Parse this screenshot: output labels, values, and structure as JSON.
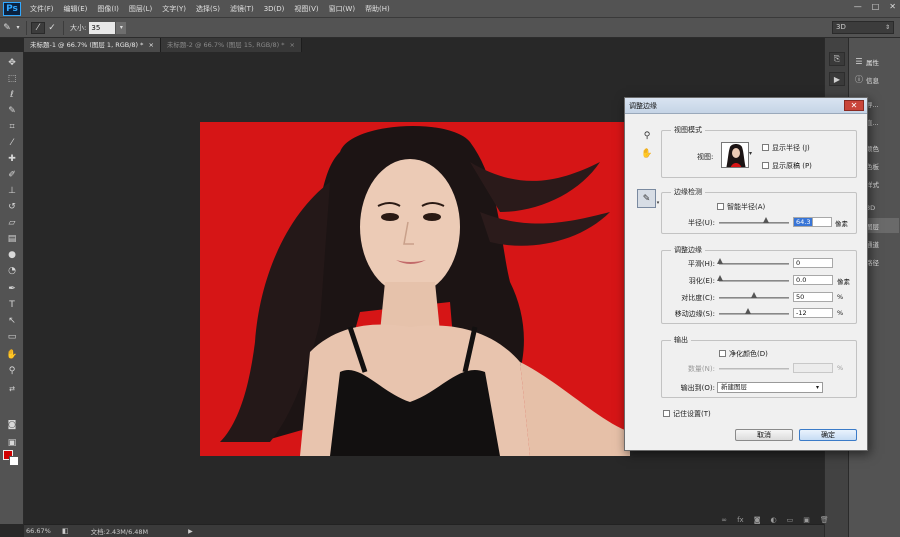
{
  "app": {
    "logo": "Ps"
  },
  "menu": [
    "文件(F)",
    "编辑(E)",
    "图像(I)",
    "图层(L)",
    "文字(Y)",
    "选择(S)",
    "滤镜(T)",
    "3D(D)",
    "视图(V)",
    "窗口(W)",
    "帮助(H)"
  ],
  "window_controls": {
    "minimize": "—",
    "maximize": "□",
    "close": "✕"
  },
  "options_bar": {
    "size_label": "大小:",
    "size_value": "35",
    "workspace": "3D"
  },
  "tabs": [
    {
      "label": "未标题-1 @ 66.7% (图层 1, RGB/8) *",
      "close": "×"
    },
    {
      "label": "未标题-2 @ 66.7% (图层 15, RGB/8) *",
      "close": "×"
    }
  ],
  "status": {
    "zoom": "66.67%",
    "doc": "文档:2.43M/6.48M"
  },
  "panels": {
    "items": [
      "属性",
      "信息",
      "导...",
      "直...",
      "颜色",
      "色板",
      "样式",
      "3D",
      "图层",
      "通道",
      "路径"
    ],
    "selected": "图层"
  },
  "colors": {
    "foreground": "#d00000",
    "background": "#ffffff",
    "canvas_bg": "#d61516",
    "accent": "#3875d7"
  },
  "dialog": {
    "title": "调整边缘",
    "view_mode": {
      "title": "视图模式",
      "view_label": "视图:",
      "show_radius": "显示半径 (J)",
      "show_original": "显示原稿 (P)"
    },
    "edge_detection": {
      "title": "边缘检测",
      "smart_radius": "智能半径(A)",
      "radius_label": "半径(U):",
      "radius_value": "64.3",
      "radius_unit": "像素"
    },
    "adjust_edge": {
      "title": "调整边缘",
      "rows": [
        {
          "label": "平滑(H):",
          "value": "0",
          "unit": ""
        },
        {
          "label": "羽化(E):",
          "value": "0.0",
          "unit": "像素"
        },
        {
          "label": "对比度(C):",
          "value": "50",
          "unit": "%"
        },
        {
          "label": "移动边缘(S):",
          "value": "-12",
          "unit": "%"
        }
      ]
    },
    "output": {
      "title": "输出",
      "decontaminate": "净化颜色(D)",
      "amount_label": "数量(N):",
      "amount_unit": "%",
      "output_to_label": "输出到(O):",
      "output_to_value": "新建图层"
    },
    "remember": "记住设置(T)",
    "cancel": "取消",
    "ok": "确定"
  }
}
